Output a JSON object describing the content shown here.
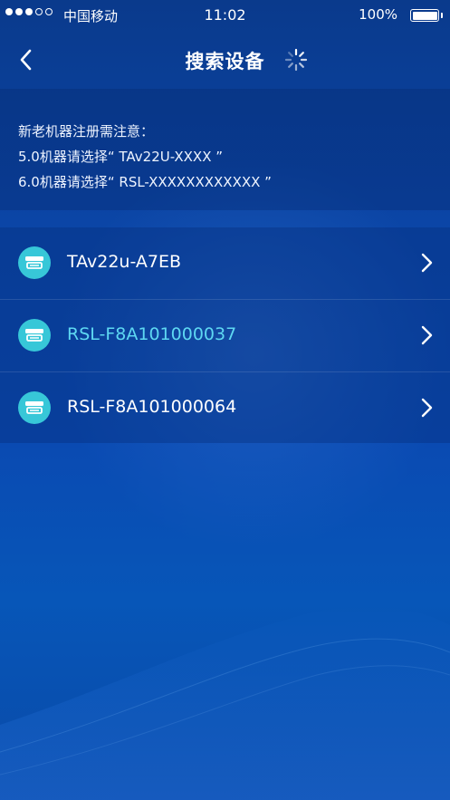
{
  "status_bar": {
    "carrier": "中国移动",
    "time": "11:02",
    "battery_percent": "100%",
    "battery_level": 1.0,
    "signal_strength": 3
  },
  "nav": {
    "title": "搜索设备",
    "back_icon": "chevron-left-icon",
    "loading_icon": "spinner-icon"
  },
  "notice": {
    "line1": "新老机器注册需注意：",
    "line2": "5.0机器请选择“ TAv22U-XXXX ”",
    "line3": "6.0机器请选择“ RSL-XXXXXXXXXXXX ”"
  },
  "devices": [
    {
      "name": "TAv22u-A7EB",
      "active": false
    },
    {
      "name": "RSL-F8A101000037",
      "active": true
    },
    {
      "name": "RSL-F8A101000064",
      "active": false
    }
  ],
  "colors": {
    "background_top": "#0a3a8c",
    "background_bottom": "#0a4aa8",
    "icon_teal": "#37c7d8",
    "active_text": "#5ed8f2"
  }
}
